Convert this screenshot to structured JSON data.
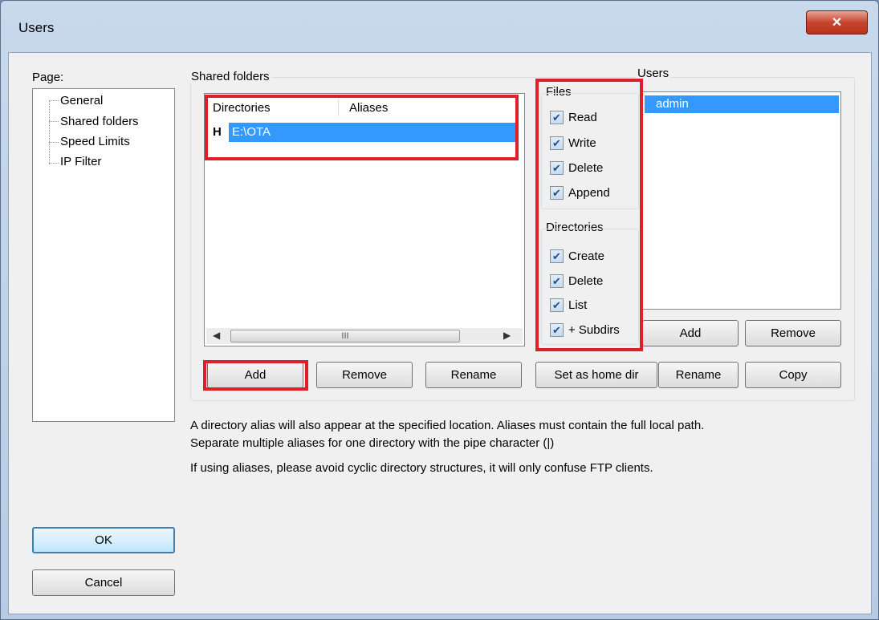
{
  "window": {
    "title": "Users",
    "close_glyph": "✕"
  },
  "page_panel": {
    "label": "Page:",
    "items": [
      "General",
      "Shared folders",
      "Speed Limits",
      "IP Filter"
    ]
  },
  "shared_folders": {
    "group_label": "Shared folders",
    "columns": [
      "Directories",
      "Aliases"
    ],
    "rows": [
      {
        "home_marker": "H",
        "directory": "E:\\OTA",
        "alias": ""
      }
    ],
    "scroll_thumb_glyph": "III",
    "buttons": {
      "add": "Add",
      "remove": "Remove",
      "rename": "Rename",
      "set_home": "Set as home dir"
    }
  },
  "files": {
    "group_label": "Files",
    "checkboxes": [
      {
        "label": "Read",
        "checked": true
      },
      {
        "label": "Write",
        "checked": true
      },
      {
        "label": "Delete",
        "checked": true
      },
      {
        "label": "Append",
        "checked": true
      }
    ]
  },
  "directories": {
    "group_label": "Directories",
    "checkboxes": [
      {
        "label": "Create",
        "checked": true
      },
      {
        "label": "Delete",
        "checked": true
      },
      {
        "label": "List",
        "checked": true
      },
      {
        "label": "+ Subdirs",
        "checked": true
      }
    ]
  },
  "users": {
    "group_label": "Users",
    "items": [
      "admin"
    ],
    "buttons": {
      "add": "Add",
      "remove": "Remove",
      "rename": "Rename",
      "copy": "Copy"
    }
  },
  "info": {
    "line1": "A directory alias will also appear at the specified location. Aliases must contain the full local path.",
    "line2": "Separate multiple aliases for one directory with the pipe character (|)",
    "line3": "If using aliases, please avoid cyclic directory structures, it will only confuse FTP clients."
  },
  "dialog_buttons": {
    "ok": "OK",
    "cancel": "Cancel"
  },
  "colors": {
    "annotation": "#e01e2a",
    "selection": "#3399ff"
  }
}
